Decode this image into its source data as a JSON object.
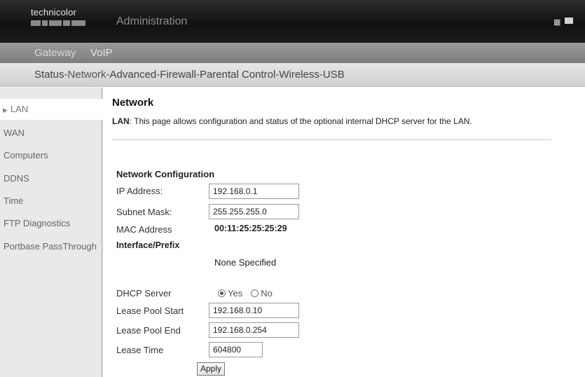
{
  "header": {
    "logo_text": "technicolor",
    "title": "Administration",
    "flag_icon": "flag-icon",
    "menu_icon": "menu-icon"
  },
  "subnav": {
    "items": [
      "Gateway",
      "VoIP"
    ]
  },
  "mainnav": {
    "items": [
      {
        "label": "Status"
      },
      {
        "label": "Network",
        "active": true
      },
      {
        "label": "Advanced"
      },
      {
        "label": "Firewall"
      },
      {
        "label": "Parental Control"
      },
      {
        "label": "Wireless"
      },
      {
        "label": "USB"
      }
    ],
    "separator": " - "
  },
  "sidebar": {
    "items": [
      {
        "label": "LAN",
        "active": true
      },
      {
        "label": "WAN"
      },
      {
        "label": "Computers"
      },
      {
        "label": "DDNS"
      },
      {
        "label": "Time"
      },
      {
        "label": "FTP Diagnostics"
      },
      {
        "label": "Portbase PassThrough"
      }
    ]
  },
  "main": {
    "title": "Network",
    "desc_strong": "LAN",
    "desc_text": ":  This page allows configuration and status of the optional internal DHCP server for the LAN.",
    "section_title": "Network Configuration",
    "ip_label": "IP Address:",
    "ip_value": "192.168.0.1",
    "subnet_label": "Subnet Mask:",
    "subnet_value": "255.255.255.0",
    "mac_label": "MAC Address",
    "mac_value": "00:11:25:25:25:29",
    "prefix_label": "Interface/Prefix",
    "prefix_value": "None Specified",
    "dhcp_label": "DHCP Server",
    "dhcp_yes": "Yes",
    "dhcp_no": "No",
    "dhcp_selected": "Yes",
    "pool_start_label": "Lease Pool Start",
    "pool_start_value": "192.168.0.10",
    "pool_end_label": "Lease Pool End",
    "pool_end_value": "192.168.0.254",
    "lease_time_label": "Lease Time",
    "lease_time_value": "604800",
    "apply_label": "Apply"
  }
}
